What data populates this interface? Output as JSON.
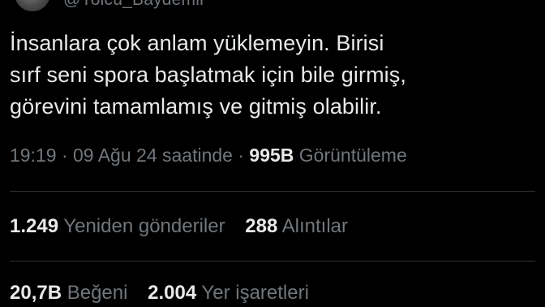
{
  "author": {
    "handle": "@Yolcu_Baydemir"
  },
  "tweet": {
    "text": "İnsanlara çok anlam yüklemeyin. Birisi\nsırf seni spora başlatmak için bile girmiş,\ngörevini tamamlamış ve gitmiş olabilir.",
    "time": "19:19",
    "separator1": " · ",
    "date": "09 Ağu 24 saatinde",
    "separator2": " · ",
    "views_count": "995B",
    "views_label": "Görüntüleme"
  },
  "stats": {
    "reposts_count": "1.249",
    "reposts_label": "Yeniden gönderiler",
    "quotes_count": "288",
    "quotes_label": "Alıntılar",
    "likes_count": "20,7B",
    "likes_label": "Beğeni",
    "bookmarks_count": "2.004",
    "bookmarks_label": "Yer işaretleri"
  }
}
